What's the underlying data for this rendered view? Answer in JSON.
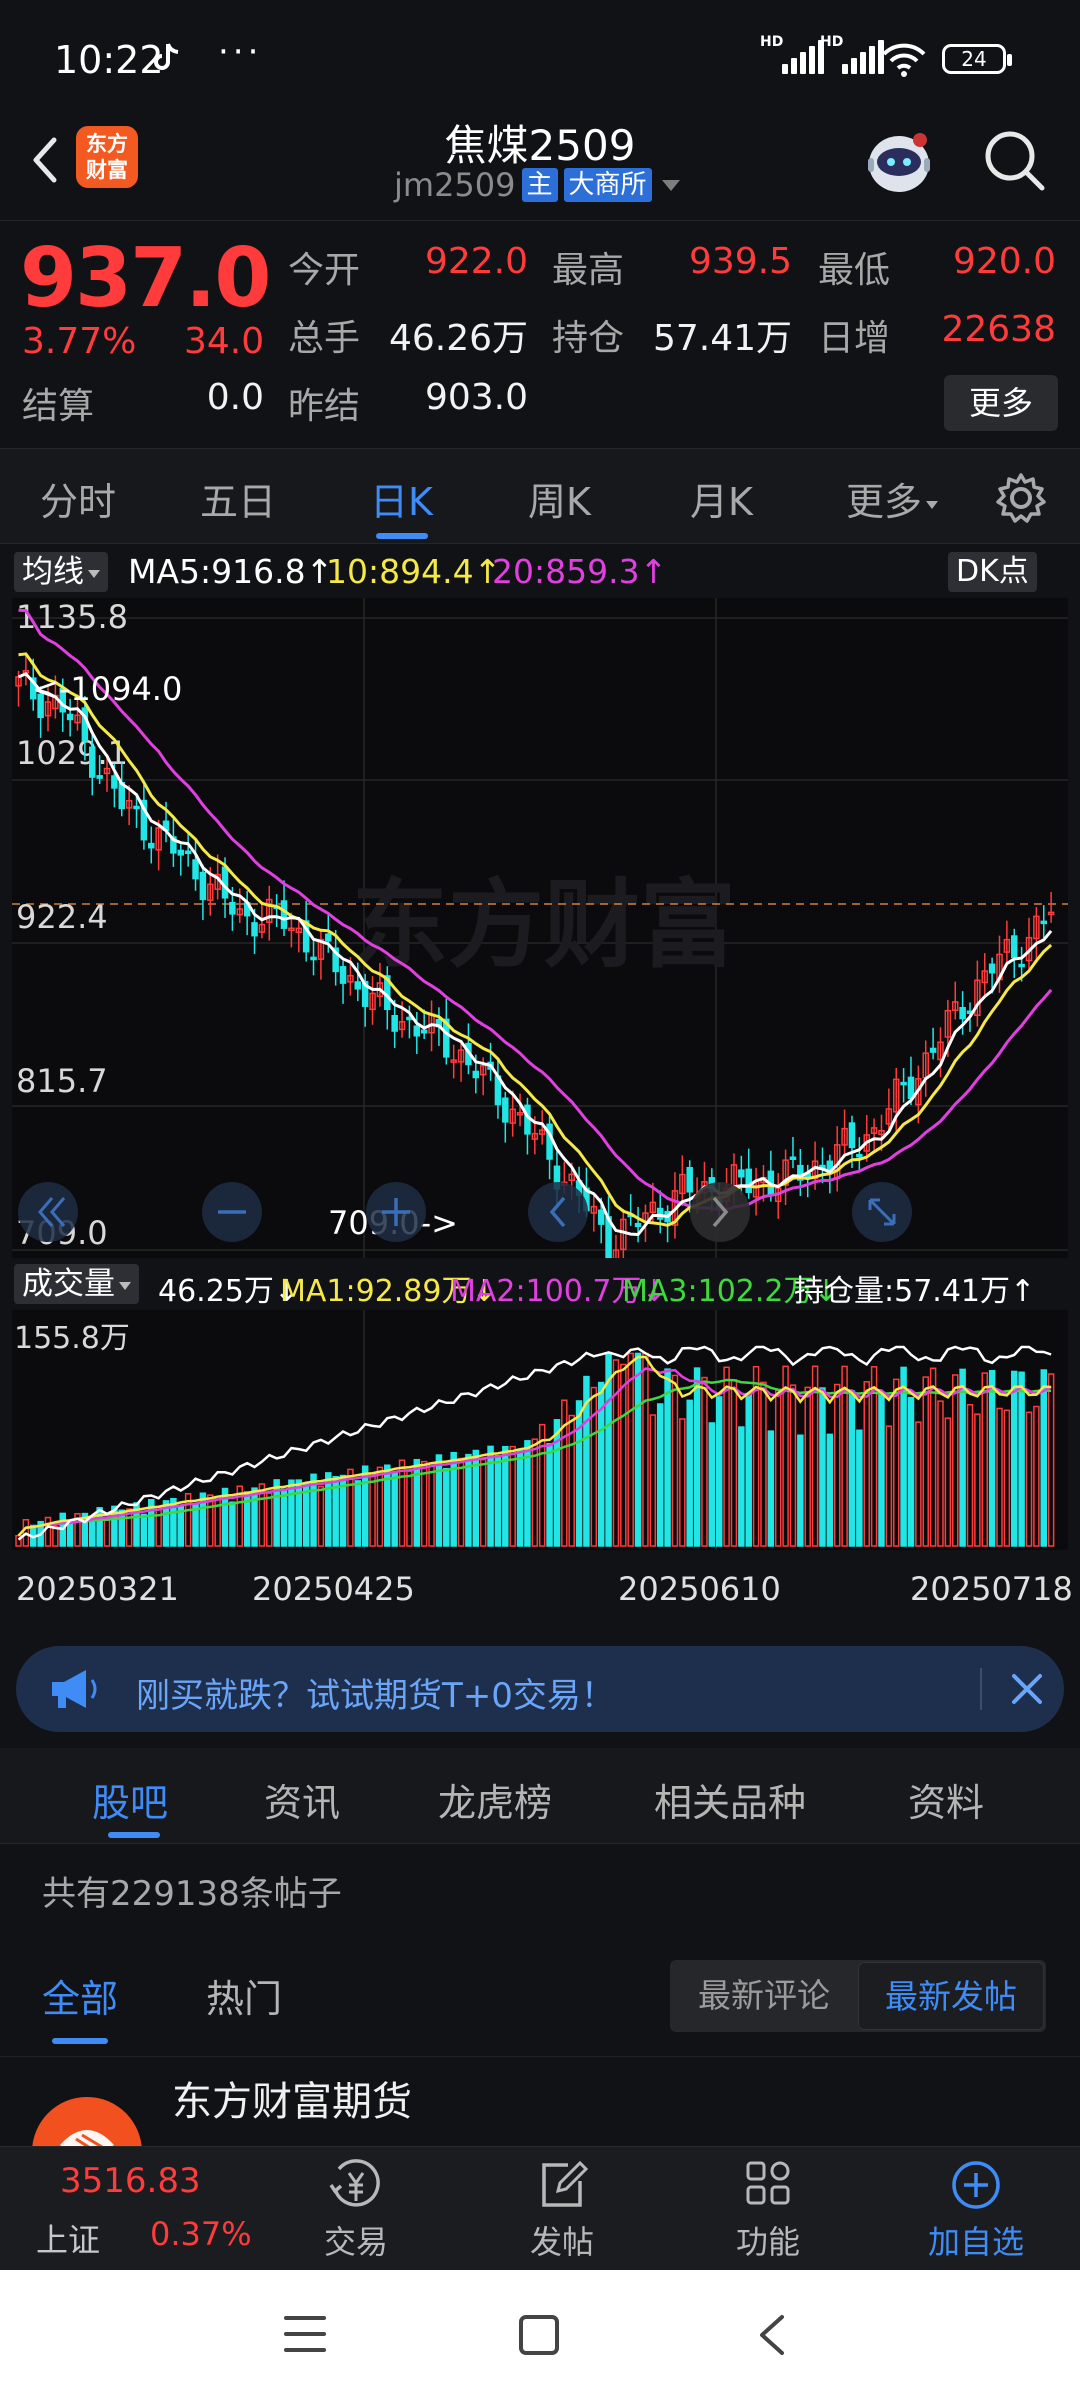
{
  "status": {
    "time": "10:22",
    "battery": "24",
    "hd1": "HD",
    "hd2": "HD"
  },
  "header": {
    "title": "焦煤2509",
    "code": "jm2509",
    "tag_main": "主",
    "tag_exchange": "大商所",
    "logo_line1": "东方",
    "logo_line2": "财富"
  },
  "quote": {
    "price": "937.0",
    "change_pct": "3.77%",
    "change_abs": "34.0",
    "fields": [
      {
        "label": "今开",
        "value": "922.0"
      },
      {
        "label": "最高",
        "value": "939.5"
      },
      {
        "label": "最低",
        "value": "920.0"
      },
      {
        "label": "总手",
        "value": "46.26万"
      },
      {
        "label": "持仓",
        "value": "57.41万"
      },
      {
        "label": "日增",
        "value": "22638"
      },
      {
        "label": "结算",
        "value": "0.0"
      },
      {
        "label": "昨结",
        "value": "903.0"
      }
    ],
    "more_label": "更多"
  },
  "period_tabs": [
    "分时",
    "五日",
    "日K",
    "周K",
    "月K",
    "更多"
  ],
  "ma_legend": {
    "selector": "均线",
    "ma5": "MA5:916.8",
    "ma10": "10:894.4",
    "ma20": "20:859.3",
    "dk": "DK点",
    "colors": {
      "ma5": "#ffffff",
      "ma10": "#f5e94a",
      "ma20": "#e040e0"
    }
  },
  "kchart": {
    "y_labels": [
      "1135.8",
      "1029.1",
      "922.4",
      "815.7",
      "709.0"
    ],
    "high_note": "<-1094.0",
    "low_note": "709.0->",
    "watermark": "东方财富",
    "ylim": [
      709.0,
      1135.8
    ],
    "current_price": 937.0
  },
  "vol_legend": {
    "selector": "成交量",
    "vol": "46.25万",
    "ma1": "MA1:92.89万",
    "ma2": "MA2:100.7万",
    "ma3": "MA3:102.2万",
    "oi": "持仓量:57.41万",
    "vol_top": "155.8万"
  },
  "dates": [
    "20250321",
    "20250425",
    "20250610",
    "20250718"
  ],
  "promo": {
    "text": "刚买就跌？试试期货T+0交易！"
  },
  "section_tabs": [
    "股吧",
    "资讯",
    "龙虎榜",
    "相关品种",
    "资料"
  ],
  "post_count": "共有229138条帖子",
  "filter": {
    "all": "全部",
    "hot": "热门",
    "sort_comment": "最新评论",
    "sort_post": "最新发帖"
  },
  "post": {
    "author": "东方财富期货"
  },
  "bottom_nav": {
    "index_value": "3516.83",
    "index_name": "上证",
    "index_pct": "0.37%",
    "items": [
      "交易",
      "发帖",
      "功能",
      "加自选"
    ]
  }
}
